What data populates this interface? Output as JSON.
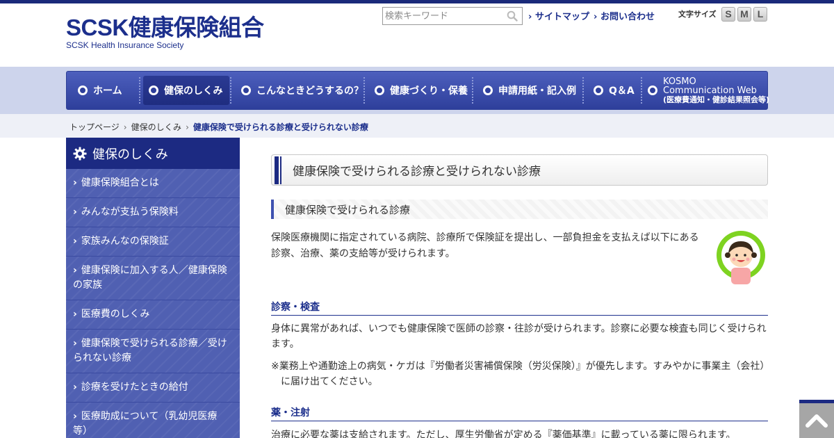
{
  "header": {
    "logo_main": "SCSK健康保険組合",
    "logo_sub": "SCSK Health Insurance Society",
    "search_placeholder": "検索キーワード",
    "links": [
      "サイトマップ",
      "お問い合わせ"
    ],
    "fontsize_label": "文字サイズ",
    "fontsize_buttons": [
      "S",
      "M",
      "L"
    ]
  },
  "nav": {
    "items": [
      "ホーム",
      "健保のしくみ",
      "こんなときどうするの？",
      "健康づくり・保養",
      "申請用紙・記入例",
      "Q＆A"
    ],
    "kosmo": {
      "line1": "KOSMO",
      "line2": "Communication Web",
      "line3": "(医療費通知・健診結果照会等)"
    }
  },
  "breadcrumb": {
    "items": [
      "トップページ",
      "健保のしくみ"
    ],
    "current": "健康保険で受けられる診療と受けられない診療"
  },
  "sidebar": {
    "title": "健保のしくみ",
    "items": [
      "健康保険組合とは",
      "みんなが支払う保険料",
      "家族みんなの保険証",
      "健康保険に加入する人／健康保険の家族",
      "医療費のしくみ",
      "健康保険で受けられる診療／受けられない診療",
      "診療を受けたときの給付",
      "医療助成について（乳幼児医療 等）"
    ]
  },
  "main": {
    "page_title": "健康保険で受けられる診療と受けられない診療",
    "section_title": "健康保険で受けられる診療",
    "intro": "保険医療機関に指定されている病院、診療所で保険証を提出し、一部負担金を支払えば以下にある診察、治療、薬の支給等が受けられます。",
    "sub1_title": "診察・検査",
    "sub1_text": "身体に異常があれば、いつでも健康保険で医師の診察・往診が受けられます。診察に必要な検査も同じく受けられます。",
    "sub1_note": "※業務上や通勤途上の病気・ケガは『労働者災害補償保険（労災保険）』が優先します。すみやかに事業主（会社）に届け出てください。",
    "sub2_title": "薬・注射",
    "sub2_text": "治療に必要な薬は支給されます。ただし、厚生労働省が定める『薬価基準』に載っている薬に限られます。"
  }
}
